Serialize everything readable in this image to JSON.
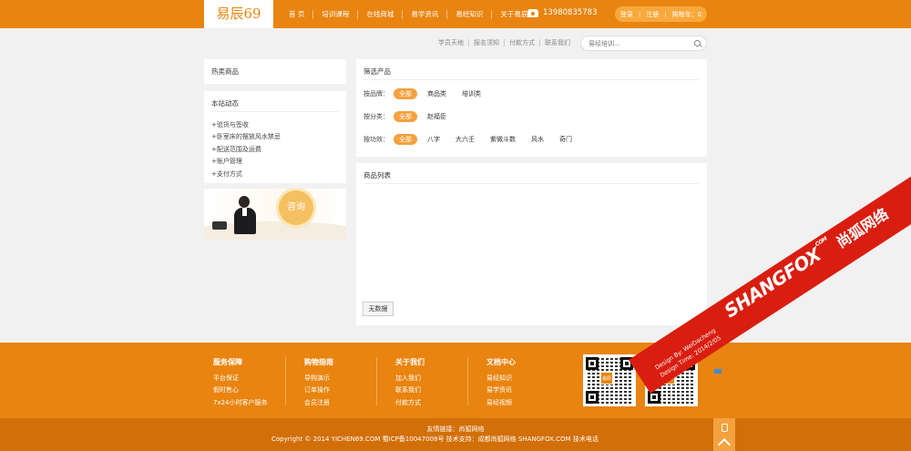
{
  "header": {
    "logo": "易辰69",
    "nav": [
      "首 页",
      "培训课程",
      "在线商城",
      "易学资讯",
      "易经知识",
      "关于易辰"
    ],
    "phone": "13980835783",
    "account": {
      "login": "登录",
      "register": "注册",
      "cart": "购物车：0"
    }
  },
  "sublinks": [
    "学员天地",
    "报名须知",
    "付款方式",
    "联系我们"
  ],
  "search": {
    "placeholder": "易经培训..."
  },
  "sidebar": {
    "hot_title": "热卖商品",
    "news_title": "本站动态",
    "news": [
      "+验货与签收",
      "+卧室床的摆放风水禁忌",
      "+配送范围及运费",
      "+账户管理",
      "+支付方式"
    ],
    "consult_label": "咨询"
  },
  "filter": {
    "title": "筛选产品",
    "rows": [
      {
        "label": "按品牌：",
        "options": [
          "全部",
          "商品类",
          "培训类"
        ]
      },
      {
        "label": "按分类：",
        "options": [
          "全部",
          "赵福臣"
        ]
      },
      {
        "label": "按功效：",
        "options": [
          "全部",
          "八字",
          "大六壬",
          "紫微斗数",
          "风水",
          "奇门"
        ]
      }
    ]
  },
  "products": {
    "title": "商品列表",
    "empty": "无数据"
  },
  "footer": {
    "columns": [
      {
        "title": "服务保障",
        "links": [
          "平台保证",
          "假时售心",
          "7x24小时客户服务"
        ]
      },
      {
        "title": "购物指南",
        "links": [
          "导购演示",
          "订单操作",
          "会员注册"
        ]
      },
      {
        "title": "关于我们",
        "links": [
          "加入我们",
          "联系我们",
          "付款方式"
        ]
      },
      {
        "title": "文档中心",
        "links": [
          "易经知识",
          "易学资讯",
          "易经视频"
        ]
      }
    ],
    "qr_logo": "易辰",
    "friend_links": "友情链接：尚狐网络",
    "copyright": "Copyright © 2014 YICHEN69.COM  蜀ICP备10047008号  技术支持：成都尚狐网络 SHANGFOX.COM  技术电话：1"
  },
  "ribbon": {
    "brand": "SHANGFOX",
    "brand_sup": ".COM",
    "cn": "尚狐网络",
    "design_by": "Design By: WeiDacheng",
    "design_time": "Design Time: 2014/2/05"
  },
  "colors": {
    "accent": "#e8840f",
    "accent_light": "#f4a13f",
    "ribbon": "#d91e10"
  }
}
